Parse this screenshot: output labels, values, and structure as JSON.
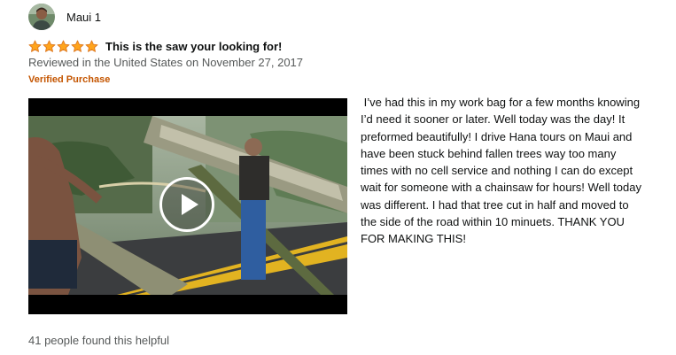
{
  "review": {
    "profile": {
      "name": "Maui 1",
      "avatar_icon": "profile-photo"
    },
    "rating": {
      "stars": 5,
      "max_stars": 5,
      "star_color": "#ffa41c",
      "star_outline": "#de7921"
    },
    "title": "This is the saw your looking for!",
    "date": "Reviewed in the United States on November 27, 2017",
    "verified": "Verified Purchase",
    "verified_color": "#c45500",
    "video": {
      "play_icon": "play-icon"
    },
    "body": " I’ve had this in my work bag for a few months knowing I’d need it sooner or later. Well today was the day! It preformed beautifully! I drive Hana tours on Maui and have been stuck behind fallen trees way too many times with no cell service and nothing I can do except wait for someone with a chainsaw for hours! Well today was different. I had that tree cut in half and moved to the side of the road within 10 minuets. THANK YOU FOR MAKING THIS!",
    "helpful": "41 people found this helpful"
  }
}
